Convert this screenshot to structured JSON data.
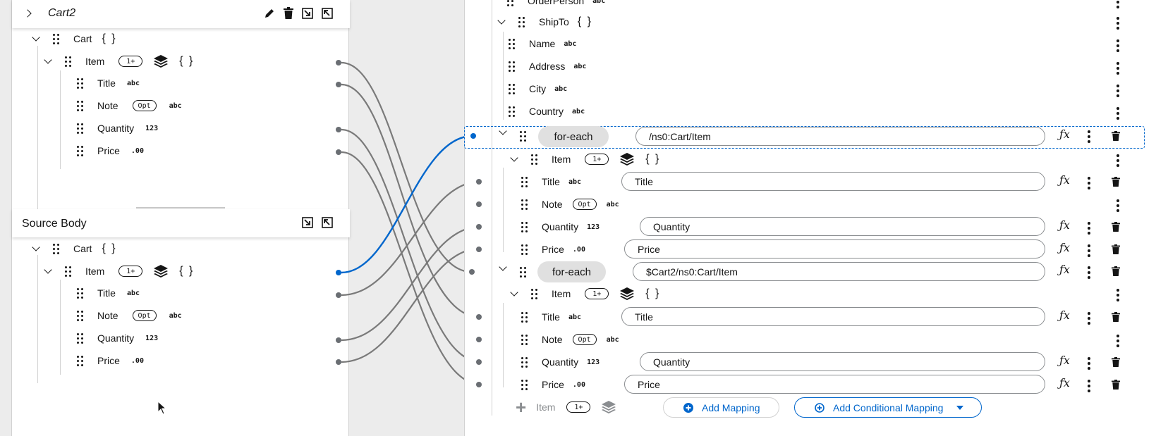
{
  "target_panel": {
    "title": "Cart2"
  },
  "target_tree": {
    "cart": {
      "label": "Cart",
      "braces": "{ }"
    },
    "item": {
      "label": "Item",
      "badge": "1+",
      "braces": "{ }"
    },
    "fields": [
      {
        "label": "Title",
        "type": "abc"
      },
      {
        "label": "Note",
        "opt": "Opt",
        "type": "abc"
      },
      {
        "label": "Quantity",
        "type": "123"
      },
      {
        "label": "Price",
        "type": ".00"
      }
    ]
  },
  "source_body": {
    "title": "Source Body"
  },
  "source_tree": {
    "cart": {
      "label": "Cart",
      "braces": "{ }"
    },
    "item": {
      "label": "Item",
      "badge": "1+",
      "braces": "{ }"
    },
    "fields": [
      {
        "label": "Title",
        "type": "abc"
      },
      {
        "label": "Note",
        "opt": "Opt",
        "type": "abc"
      },
      {
        "label": "Quantity",
        "type": "123"
      },
      {
        "label": "Price",
        "type": ".00"
      }
    ]
  },
  "mapping": {
    "partial_top": {
      "label": "OrderPerson",
      "type": "abc"
    },
    "shipto": {
      "label": "ShipTo",
      "braces": "{ }"
    },
    "shipto_fields": [
      {
        "label": "Name",
        "type": "abc"
      },
      {
        "label": "Address",
        "type": "abc"
      },
      {
        "label": "City",
        "type": "abc"
      },
      {
        "label": "Country",
        "type": "abc"
      }
    ],
    "foreach1": {
      "label": "for-each",
      "expression": "/ns0:Cart/Item",
      "item": {
        "label": "Item",
        "badge": "1+",
        "braces": "{ }"
      },
      "fields": [
        {
          "label": "Title",
          "type": "abc",
          "expression": "Title"
        },
        {
          "label": "Note",
          "opt": "Opt",
          "type": "abc"
        },
        {
          "label": "Quantity",
          "type": "123",
          "expression": "Quantity"
        },
        {
          "label": "Price",
          "type": ".00",
          "expression": "Price"
        }
      ]
    },
    "foreach2": {
      "label": "for-each",
      "expression": "$Cart2/ns0:Cart/Item",
      "item": {
        "label": "Item",
        "badge": "1+",
        "braces": "{ }"
      },
      "fields": [
        {
          "label": "Title",
          "type": "abc",
          "expression": "Title"
        },
        {
          "label": "Note",
          "opt": "Opt",
          "type": "abc"
        },
        {
          "label": "Quantity",
          "type": "123",
          "expression": "Quantity"
        },
        {
          "label": "Price",
          "type": ".00",
          "expression": "Price"
        }
      ]
    },
    "footer": {
      "item_label": "Item",
      "item_badge": "1+",
      "add_mapping": "Add Mapping",
      "add_conditional": "Add Conditional Mapping"
    }
  },
  "colors": {
    "accent": "#0066cc",
    "line": "#6a6e73",
    "pill": "#e0e0e0"
  }
}
